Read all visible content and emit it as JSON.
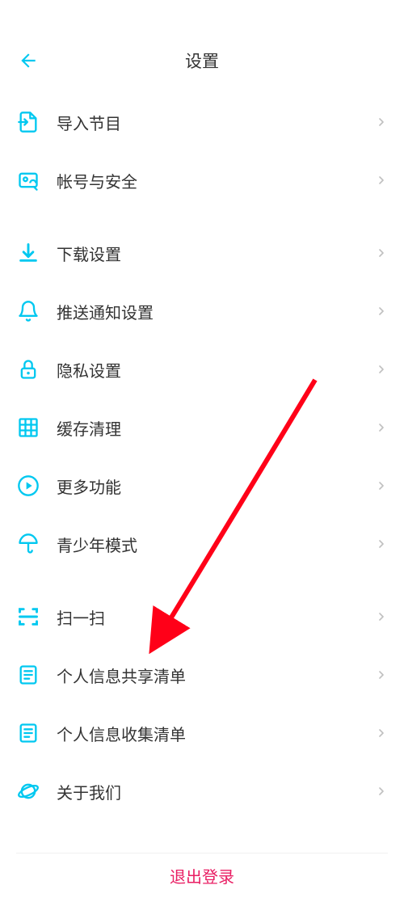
{
  "colors": {
    "accent": "#00c8f0",
    "chevron": "#c0c0c0",
    "text": "#333333",
    "logout": "#e91e63",
    "arrow": "#ff0018"
  },
  "nav": {
    "title": "设置"
  },
  "groups": [
    {
      "items": [
        {
          "icon": "import-icon",
          "key": "import",
          "label": "导入节目"
        },
        {
          "icon": "account-icon",
          "key": "account",
          "label": "帐号与安全"
        }
      ]
    },
    {
      "items": [
        {
          "icon": "download-icon",
          "key": "download",
          "label": "下载设置"
        },
        {
          "icon": "bell-icon",
          "key": "push",
          "label": "推送通知设置"
        },
        {
          "icon": "lock-icon",
          "key": "privacy",
          "label": "隐私设置"
        },
        {
          "icon": "grid-icon",
          "key": "cache",
          "label": "缓存清理"
        },
        {
          "icon": "play-icon",
          "key": "more",
          "label": "更多功能"
        },
        {
          "icon": "umbrella-icon",
          "key": "teen",
          "label": "青少年模式"
        }
      ]
    },
    {
      "items": [
        {
          "icon": "scan-icon",
          "key": "scan",
          "label": "扫一扫"
        },
        {
          "icon": "doc-icon",
          "key": "share-info",
          "label": "个人信息共享清单"
        },
        {
          "icon": "doc-icon",
          "key": "collect-info",
          "label": "个人信息收集清单"
        },
        {
          "icon": "planet-icon",
          "key": "about",
          "label": "关于我们"
        }
      ]
    }
  ],
  "logout": {
    "label": "退出登录"
  }
}
